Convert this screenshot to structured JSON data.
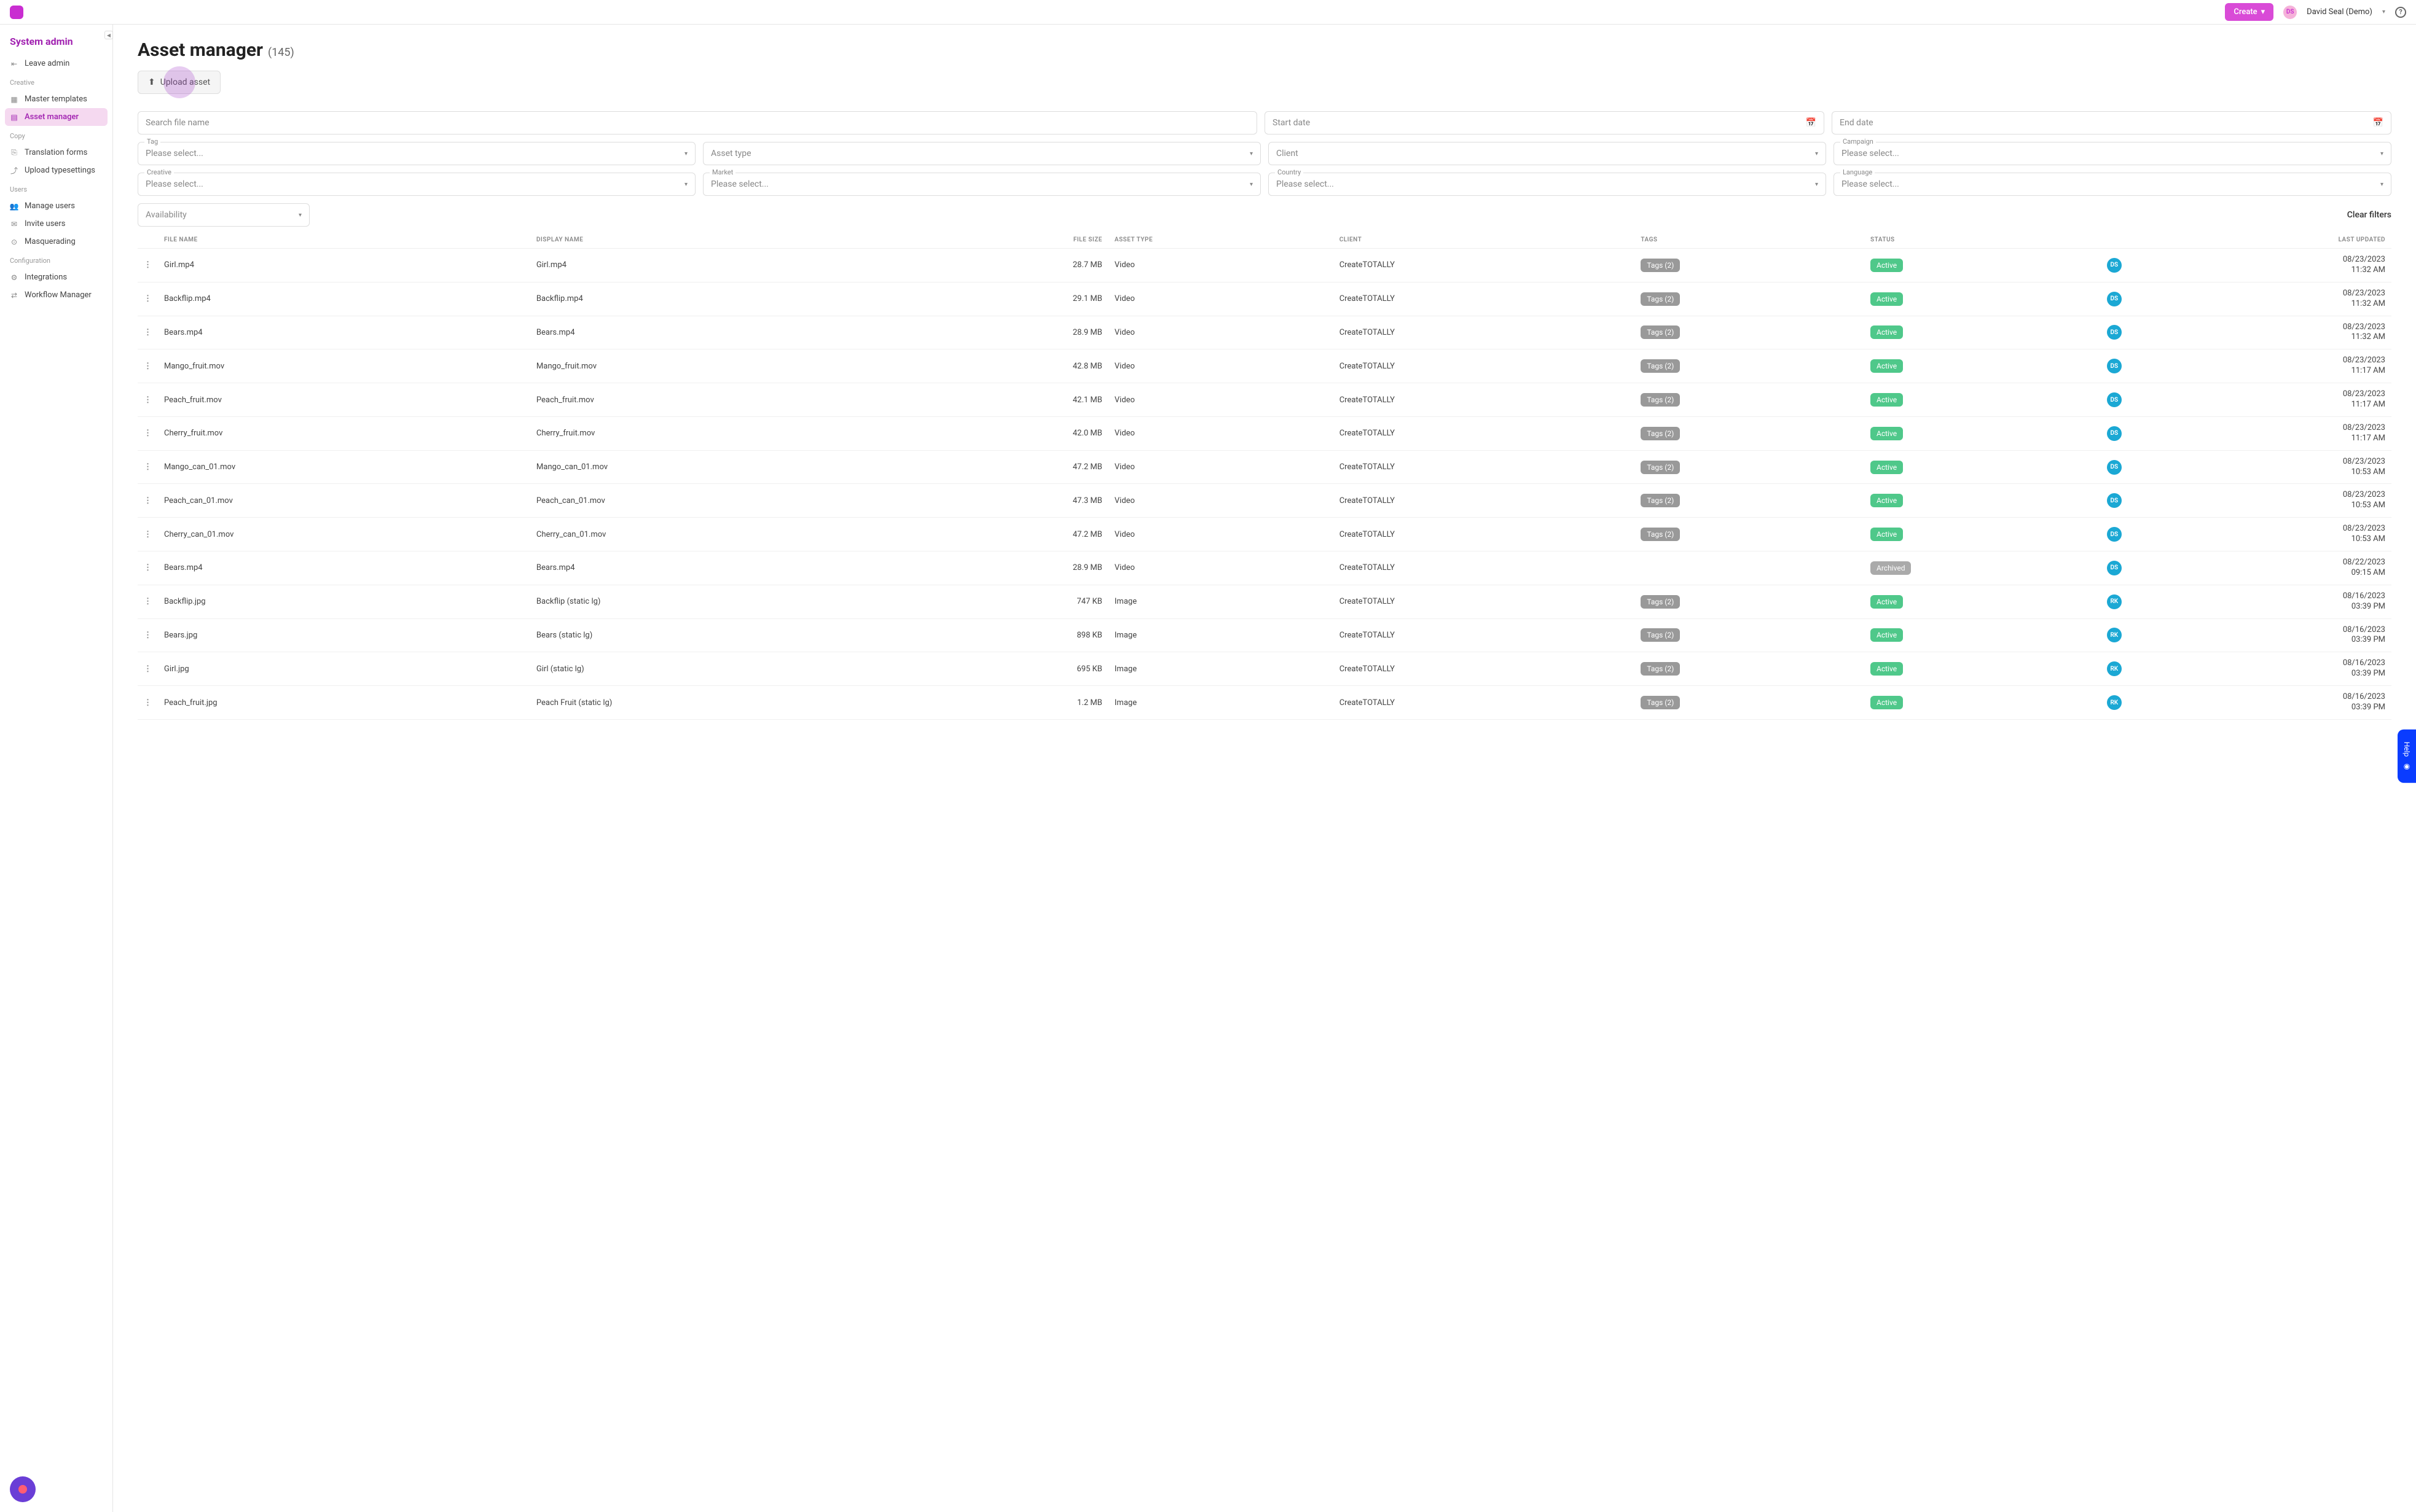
{
  "header": {
    "create_label": "Create",
    "user_initials": "DS",
    "user_name": "David Seal (Demo)"
  },
  "sidebar": {
    "title": "System admin",
    "leave_admin": "Leave admin",
    "sections": {
      "creative": "Creative",
      "copy": "Copy",
      "users": "Users",
      "configuration": "Configuration"
    },
    "items": {
      "master_templates": "Master templates",
      "asset_manager": "Asset manager",
      "translation_forms": "Translation forms",
      "upload_typesettings": "Upload typesettings",
      "manage_users": "Manage users",
      "invite_users": "Invite users",
      "masquerading": "Masquerading",
      "integrations": "Integrations",
      "workflow_manager": "Workflow Manager"
    }
  },
  "page": {
    "title": "Asset manager",
    "count": "(145)",
    "upload_label": "Upload asset"
  },
  "filters": {
    "search_placeholder": "Search file name",
    "start_date": "Start date",
    "end_date": "End date",
    "tag_label": "Tag",
    "tag_value": "Please select...",
    "asset_type": "Asset type",
    "client": "Client",
    "campaign_label": "Campaign",
    "campaign_value": "Please select...",
    "creative_label": "Creative",
    "creative_value": "Please select...",
    "market_label": "Market",
    "market_value": "Please select...",
    "country_label": "Country",
    "country_value": "Please select...",
    "language_label": "Language",
    "language_value": "Please select...",
    "availability": "Availability",
    "clear_filters": "Clear filters"
  },
  "table": {
    "headers": {
      "file_name": "FILE NAME",
      "display_name": "DISPLAY NAME",
      "file_size": "FILE SIZE",
      "asset_type": "ASSET TYPE",
      "client": "CLIENT",
      "tags": "TAGS",
      "status": "STATUS",
      "last_updated": "LAST UPDATED"
    },
    "rows": [
      {
        "file_name": "Girl.mp4",
        "display_name": "Girl.mp4",
        "file_size": "28.7 MB",
        "asset_type": "Video",
        "client": "CreateTOTALLY",
        "tags": "Tags (2)",
        "status": "Active",
        "user": "DS",
        "date": "08/23/2023",
        "time": "11:32 AM"
      },
      {
        "file_name": "Backflip.mp4",
        "display_name": "Backflip.mp4",
        "file_size": "29.1 MB",
        "asset_type": "Video",
        "client": "CreateTOTALLY",
        "tags": "Tags (2)",
        "status": "Active",
        "user": "DS",
        "date": "08/23/2023",
        "time": "11:32 AM"
      },
      {
        "file_name": "Bears.mp4",
        "display_name": "Bears.mp4",
        "file_size": "28.9 MB",
        "asset_type": "Video",
        "client": "CreateTOTALLY",
        "tags": "Tags (2)",
        "status": "Active",
        "user": "DS",
        "date": "08/23/2023",
        "time": "11:32 AM"
      },
      {
        "file_name": "Mango_fruit.mov",
        "display_name": "Mango_fruit.mov",
        "file_size": "42.8 MB",
        "asset_type": "Video",
        "client": "CreateTOTALLY",
        "tags": "Tags (2)",
        "status": "Active",
        "user": "DS",
        "date": "08/23/2023",
        "time": "11:17 AM"
      },
      {
        "file_name": "Peach_fruit.mov",
        "display_name": "Peach_fruit.mov",
        "file_size": "42.1 MB",
        "asset_type": "Video",
        "client": "CreateTOTALLY",
        "tags": "Tags (2)",
        "status": "Active",
        "user": "DS",
        "date": "08/23/2023",
        "time": "11:17 AM"
      },
      {
        "file_name": "Cherry_fruit.mov",
        "display_name": "Cherry_fruit.mov",
        "file_size": "42.0 MB",
        "asset_type": "Video",
        "client": "CreateTOTALLY",
        "tags": "Tags (2)",
        "status": "Active",
        "user": "DS",
        "date": "08/23/2023",
        "time": "11:17 AM"
      },
      {
        "file_name": "Mango_can_01.mov",
        "display_name": "Mango_can_01.mov",
        "file_size": "47.2 MB",
        "asset_type": "Video",
        "client": "CreateTOTALLY",
        "tags": "Tags (2)",
        "status": "Active",
        "user": "DS",
        "date": "08/23/2023",
        "time": "10:53 AM"
      },
      {
        "file_name": "Peach_can_01.mov",
        "display_name": "Peach_can_01.mov",
        "file_size": "47.3 MB",
        "asset_type": "Video",
        "client": "CreateTOTALLY",
        "tags": "Tags (2)",
        "status": "Active",
        "user": "DS",
        "date": "08/23/2023",
        "time": "10:53 AM"
      },
      {
        "file_name": "Cherry_can_01.mov",
        "display_name": "Cherry_can_01.mov",
        "file_size": "47.2 MB",
        "asset_type": "Video",
        "client": "CreateTOTALLY",
        "tags": "Tags (2)",
        "status": "Active",
        "user": "DS",
        "date": "08/23/2023",
        "time": "10:53 AM"
      },
      {
        "file_name": "Bears.mp4",
        "display_name": "Bears.mp4",
        "file_size": "28.9 MB",
        "asset_type": "Video",
        "client": "CreateTOTALLY",
        "tags": "",
        "status": "Archived",
        "user": "DS",
        "date": "08/22/2023",
        "time": "09:15 AM"
      },
      {
        "file_name": "Backflip.jpg",
        "display_name": "Backflip (static lg)",
        "file_size": "747 KB",
        "asset_type": "Image",
        "client": "CreateTOTALLY",
        "tags": "Tags (2)",
        "status": "Active",
        "user": "RK",
        "date": "08/16/2023",
        "time": "03:39 PM"
      },
      {
        "file_name": "Bears.jpg",
        "display_name": "Bears (static lg)",
        "file_size": "898 KB",
        "asset_type": "Image",
        "client": "CreateTOTALLY",
        "tags": "Tags (2)",
        "status": "Active",
        "user": "RK",
        "date": "08/16/2023",
        "time": "03:39 PM"
      },
      {
        "file_name": "Girl.jpg",
        "display_name": "Girl (static lg)",
        "file_size": "695 KB",
        "asset_type": "Image",
        "client": "CreateTOTALLY",
        "tags": "Tags (2)",
        "status": "Active",
        "user": "RK",
        "date": "08/16/2023",
        "time": "03:39 PM"
      },
      {
        "file_name": "Peach_fruit.jpg",
        "display_name": "Peach Fruit (static lg)",
        "file_size": "1.2 MB",
        "asset_type": "Image",
        "client": "CreateTOTALLY",
        "tags": "Tags (2)",
        "status": "Active",
        "user": "RK",
        "date": "08/16/2023",
        "time": "03:39 PM"
      }
    ]
  },
  "help_tab": "Help"
}
